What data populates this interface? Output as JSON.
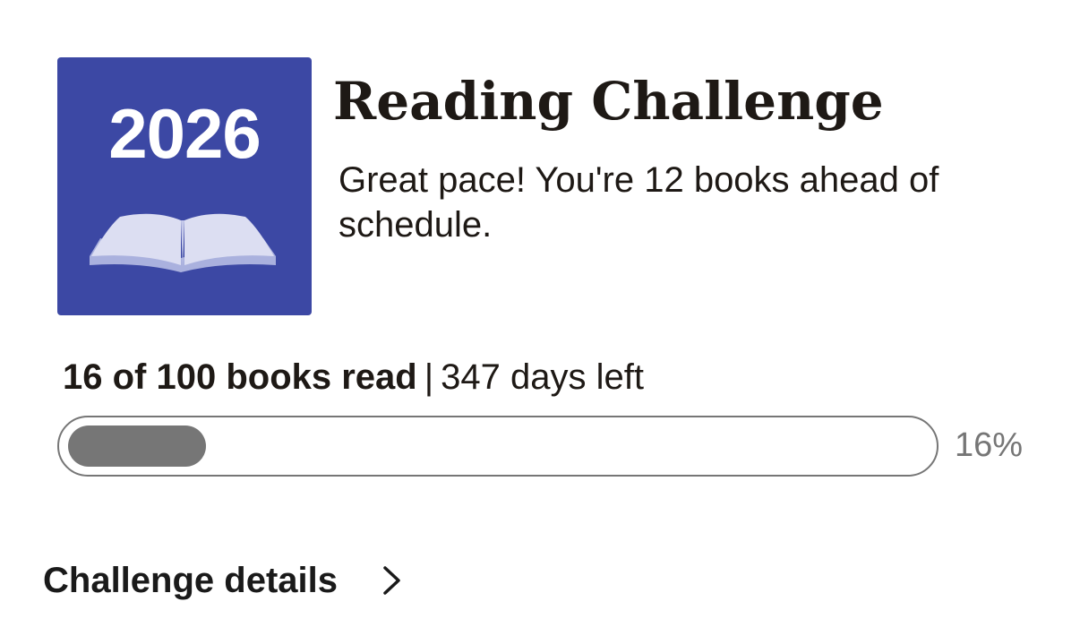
{
  "badge": {
    "year": "2026",
    "background_color": "#3c48a4",
    "book_icon": "open-book-icon"
  },
  "header": {
    "title": "Reading Challenge",
    "pace_message": "Great pace! You're 12 books ahead of schedule."
  },
  "progress": {
    "books_read_text": "16 of 100 books read",
    "separator": "|",
    "days_left_text": "347 days left",
    "percent_text": "16%",
    "percent_value": 16,
    "fill_color": "#767676"
  },
  "details_link": {
    "label": "Challenge details",
    "icon": "chevron-right-icon"
  }
}
